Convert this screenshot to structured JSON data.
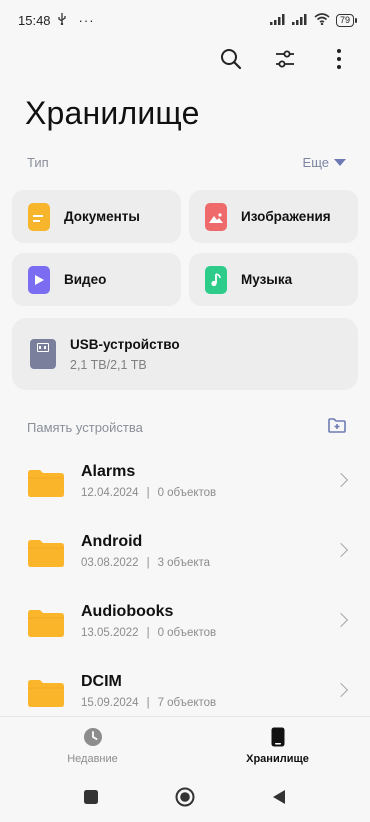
{
  "status_bar": {
    "time": "15:48",
    "usb_symbol": "⚲",
    "dots": "···",
    "battery": "79"
  },
  "toolbar": {
    "icons": [
      "search-icon",
      "filter-sliders-icon",
      "more-vertical-icon"
    ]
  },
  "page": {
    "title": "Хранилище"
  },
  "type_section": {
    "label": "Тип",
    "more_label": "Еще"
  },
  "categories": [
    {
      "label": "Документы",
      "icon": "document-icon",
      "color": "#f7b52c"
    },
    {
      "label": "Изображения",
      "icon": "image-icon",
      "color": "#ef6b6b"
    },
    {
      "label": "Видео",
      "icon": "video-icon",
      "color": "#7b6df2"
    },
    {
      "label": "Музыка",
      "icon": "music-icon",
      "color": "#2ecc8a"
    }
  ],
  "usb": {
    "title": "USB-устройство",
    "size": "2,1 TB/2,1 TB"
  },
  "device_section": {
    "label": "Память устройства"
  },
  "folders": [
    {
      "name": "Alarms",
      "date": "12.04.2024",
      "sep": "|",
      "count": "0 объектов"
    },
    {
      "name": "Android",
      "date": "03.08.2022",
      "sep": "|",
      "count": "3 объекта"
    },
    {
      "name": "Audiobooks",
      "date": "13.05.2022",
      "sep": "|",
      "count": "0 объектов"
    },
    {
      "name": "DCIM",
      "date": "15.09.2024",
      "sep": "|",
      "count": "7 объектов"
    }
  ],
  "bottom_nav": {
    "recent_label": "Недавние",
    "storage_label": "Хранилище"
  },
  "colors": {
    "folder": "#fbb52b",
    "accent": "#6e7bb3",
    "usb": "#7a7f9c"
  }
}
